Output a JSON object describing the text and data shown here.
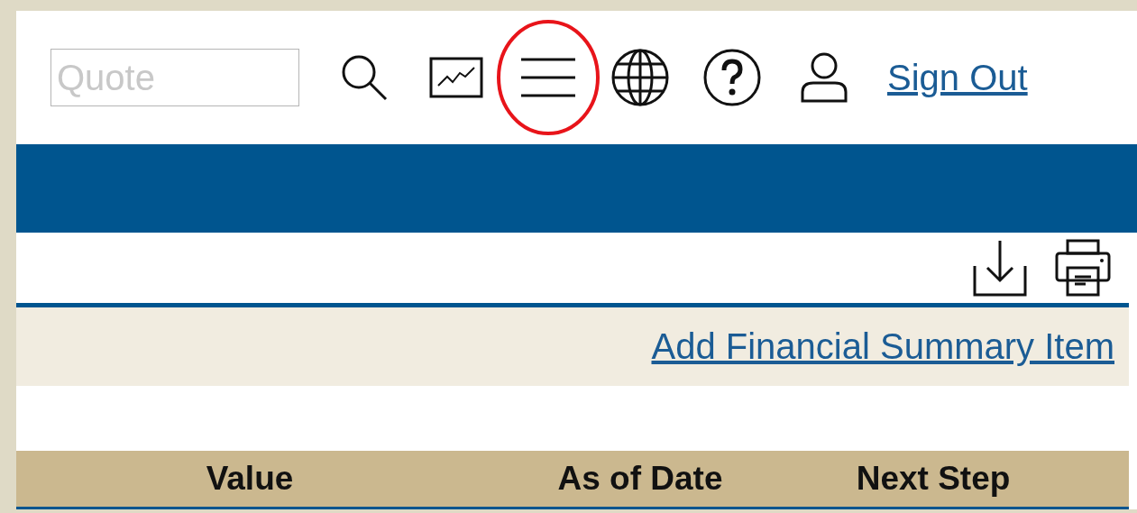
{
  "toolbar": {
    "quote_field": {
      "placeholder": "Quote"
    },
    "icons": [
      {
        "kind": "search",
        "highlighted": false
      },
      {
        "kind": "chart",
        "highlighted": false
      },
      {
        "kind": "menu",
        "highlighted": true
      },
      {
        "kind": "globe",
        "highlighted": false
      },
      {
        "kind": "help",
        "highlighted": false
      },
      {
        "kind": "user",
        "highlighted": false
      }
    ],
    "sign_out": "Sign Out"
  },
  "actions": [
    {
      "kind": "download"
    },
    {
      "kind": "print"
    }
  ],
  "add_link": "Add Financial Summary Item",
  "table": {
    "columns": [
      "Value",
      "As of Date",
      "Next Step"
    ]
  }
}
